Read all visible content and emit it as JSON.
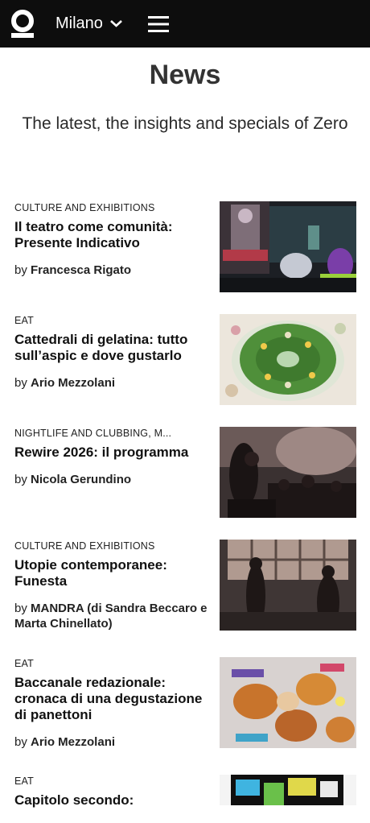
{
  "header": {
    "city": "Milano",
    "icons": [
      "zero-logo-icon",
      "chevron-down-icon",
      "menu-icon"
    ]
  },
  "page": {
    "title": "News",
    "subtitle": "The latest, the insights and specials of Zero"
  },
  "articles": [
    {
      "category": "CULTURE AND EXHIBITIONS",
      "title": "Il teatro come comunità: Presente Indicativo",
      "by": "by",
      "author": "Francesca Rigato"
    },
    {
      "category": "EAT",
      "title": "Cattedrali di gelatina: tutto sull’aspic e dove gustarlo",
      "by": "by",
      "author": "Ario Mezzolani"
    },
    {
      "category": "NIGHTLIFE AND CLUBBING, M...",
      "title": "Rewire 2026: il programma",
      "by": "by",
      "author": "Nicola Gerundino"
    },
    {
      "category": "CULTURE AND EXHIBITIONS",
      "title": "Utopie contemporanee: Funesta",
      "by": "by",
      "author": "MANDRA (di Sandra Beccaro e Marta Chinellato)"
    },
    {
      "category": "EAT",
      "title": "Baccanale redazionale: cronaca di una degustazione di panettoni",
      "by": "by",
      "author": "Ario Mezzolani"
    },
    {
      "category": "EAT",
      "title": "Capitolo secondo:"
    }
  ]
}
